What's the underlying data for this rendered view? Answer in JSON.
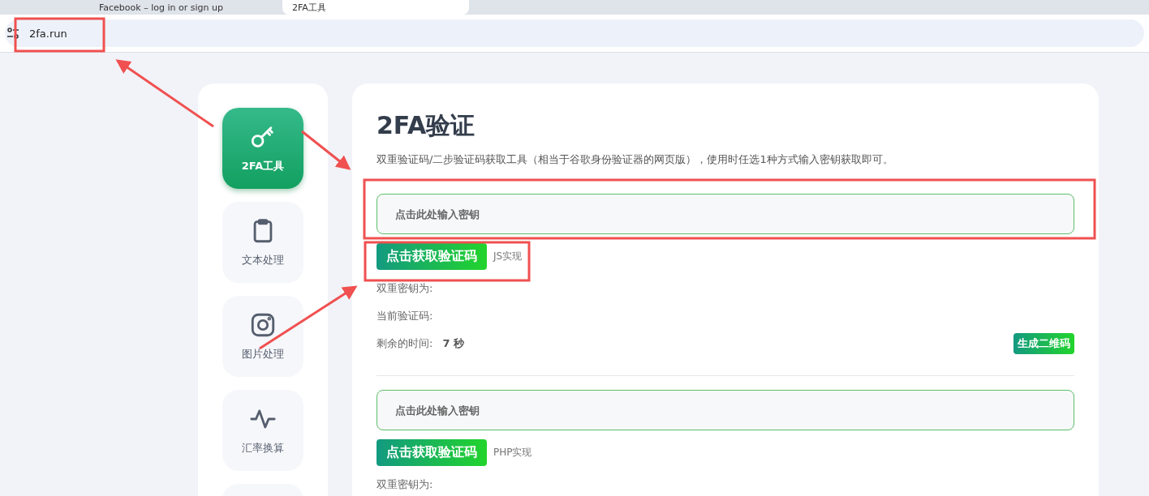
{
  "browser": {
    "tabs": [
      {
        "title": "Facebook – log in or sign up",
        "selected": false
      },
      {
        "title": "2FA工具",
        "selected": true
      }
    ],
    "address": "2fa.run"
  },
  "sidebar": {
    "items": [
      {
        "label": "2FA工具",
        "kind": "key",
        "selected": true
      },
      {
        "label": "文本处理",
        "kind": "clipboard",
        "selected": false
      },
      {
        "label": "图片处理",
        "kind": "camera",
        "selected": false
      },
      {
        "label": "汇率换算",
        "kind": "pulse",
        "selected": false
      }
    ]
  },
  "main": {
    "title": "2FA验证",
    "description": "双重验证码/二步验证码获取工具（相当于谷歌身份验证器的网页版），使用时任选1种方式输入密钥获取即可。",
    "sections": [
      {
        "placeholder": "点击此处输入密钥",
        "button": "点击获取验证码",
        "note": "JS实现",
        "fields": [
          {
            "label": "双重密钥为:"
          },
          {
            "label": "当前验证码:"
          },
          {
            "label": "剩余的时间:",
            "value": "7 秒"
          }
        ],
        "qr_button": "生成二维码"
      },
      {
        "placeholder": "点击此处输入密钥",
        "button": "点击获取验证码",
        "note": "PHP实现",
        "fields": [
          {
            "label": "双重密钥为:"
          }
        ]
      }
    ]
  }
}
